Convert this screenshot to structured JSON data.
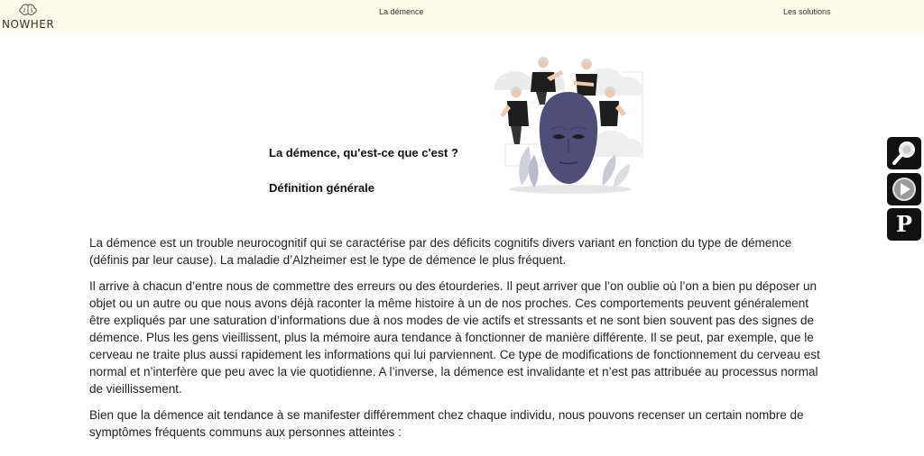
{
  "nav": {
    "logo_text": "NOWHER",
    "logo_icon": "brain-icon",
    "links": [
      "La démence",
      "Les solutions"
    ]
  },
  "hero": {
    "title": "La démence, qu'est-ce que c'est ?",
    "subtitle": "Définition générale",
    "illustration": "masked-face-with-elderly-people-illustration"
  },
  "content": {
    "paragraphs": [
      "La démence est un trouble neurocognitif qui se caractérise par des déficits cognitifs divers variant en fonction du type de démence (définis par leur cause). La maladie d’Alzheimer est le type de démence le plus fréquent.",
      "Il arrive à chacun d’entre nous de commettre des erreurs ou des étourderies. Il peut arriver que l’on oublie où l’on a bien pu déposer un objet ou un autre ou que nous avons déjà raconter la même histoire à un de nos proches. Ces comportements peuvent généralement être expliqués par une saturation d’informations due à nos modes de vie actifs et stressants et ne sont bien souvent pas des signes de démence. Plus les gens vieillissent, plus la mémoire aura tendance à fonctionner de manière différente. Il se peut, par exemple, que le cerveau ne traite plus aussi rapidement les informations qui lui parviennent. Ce type de modifications de fonctionnement du cerveau est normal et n’interfère que peu avec la vie quotidienne. A l’inverse, la démence est invalidante et n’est pas attribuée au processus normal de vieillissement.",
      "Bien que la démence ait tendance à se manifester différemment chez chaque individu, nous pouvons recenser un certain nombre de symptômes fréquents communs aux personnes atteintes :"
    ]
  },
  "toolbar": {
    "buttons": [
      "magnifier-icon",
      "play-icon",
      "p-icon"
    ],
    "p_label": "P"
  },
  "colors": {
    "navbar_bg": "#fdfbea",
    "mask": "#4e4f78",
    "toolbar_bg": "#111111"
  }
}
